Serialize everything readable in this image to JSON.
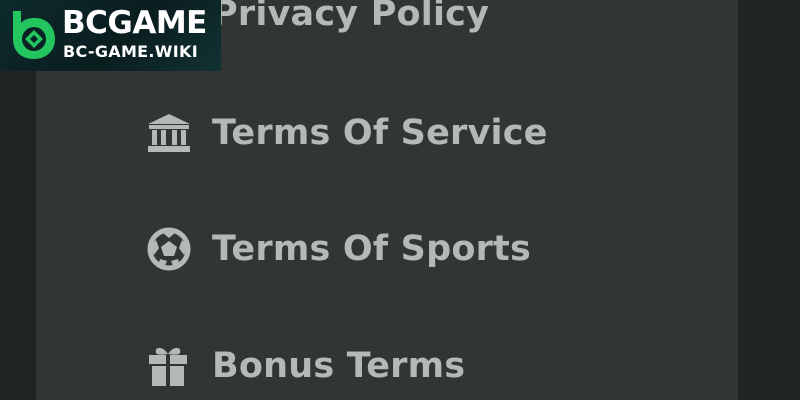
{
  "menu": {
    "items": [
      {
        "label": "Privacy Policy",
        "icon": "shield-icon"
      },
      {
        "label": "Terms Of Service",
        "icon": "bank-icon"
      },
      {
        "label": "Terms Of Sports",
        "icon": "soccer-ball-icon"
      },
      {
        "label": "Bonus Terms",
        "icon": "gift-icon"
      }
    ]
  },
  "watermark": {
    "brand": "BCGAME",
    "site": "BC-GAME.WIKI"
  },
  "colors": {
    "background": "#212424",
    "panel": "#323535",
    "text": "#b3b8b8",
    "logo_green": "#22c55e"
  }
}
